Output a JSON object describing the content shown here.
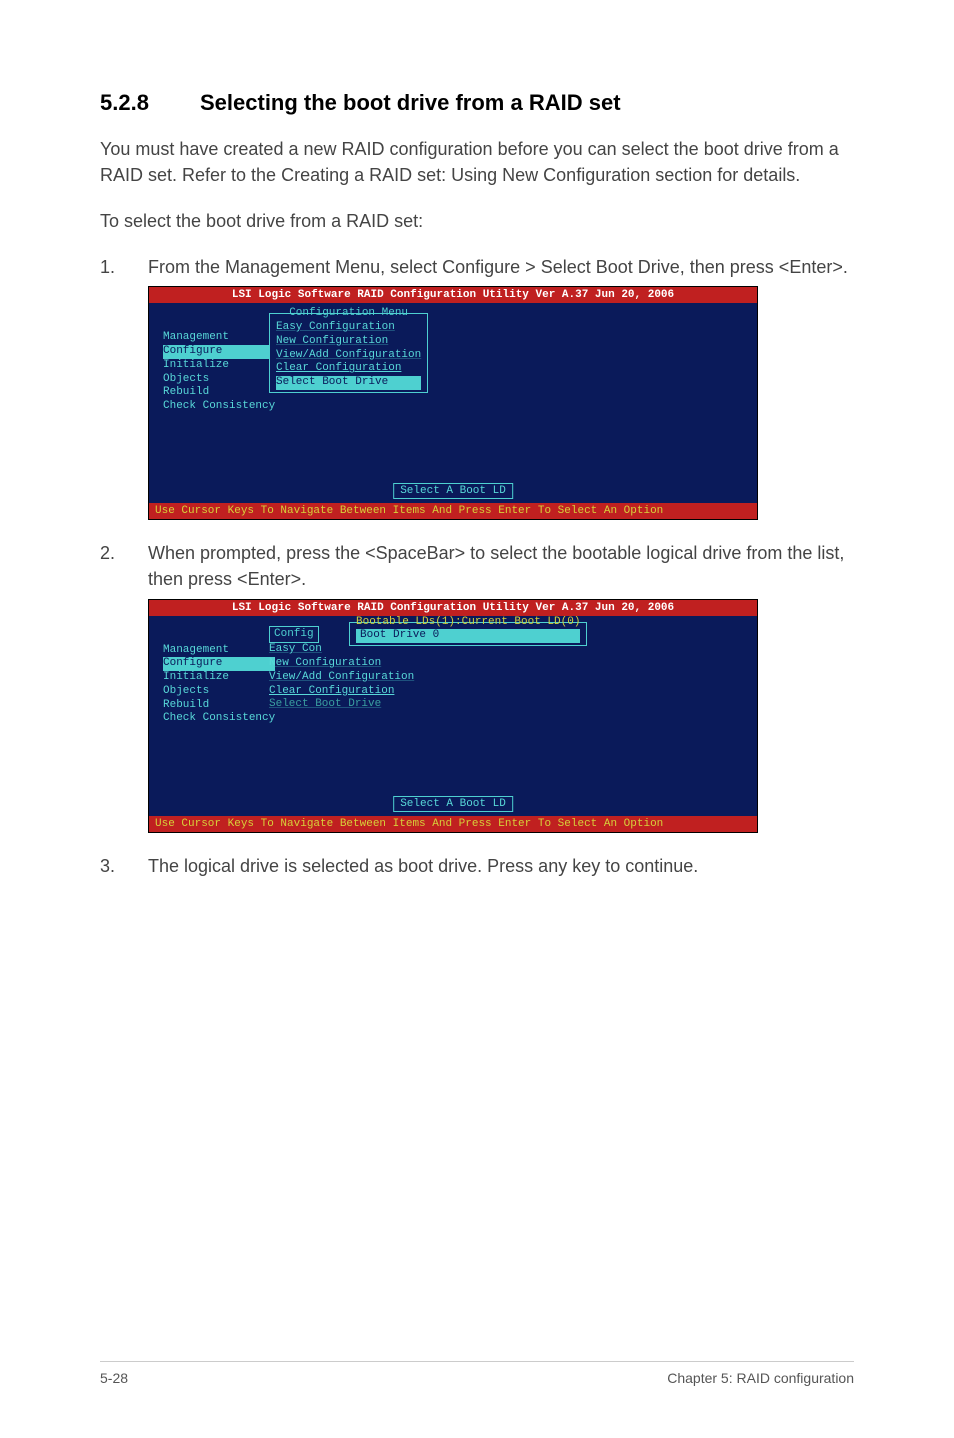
{
  "heading": {
    "number": "5.2.8",
    "title": "Selecting the boot drive from a RAID set"
  },
  "intro": "You must have created a new RAID configuration before you can select the boot drive from a RAID set. Refer to the Creating a RAID set: Using New Configuration section for details.",
  "lead": "To select the boot drive from a RAID set:",
  "steps": {
    "s1": {
      "num": "1.",
      "text": "From the Management Menu, select Configure > Select Boot Drive, then press <Enter>."
    },
    "s2": {
      "num": "2.",
      "text": "When prompted, press the <SpaceBar> to select the bootable logical drive from the list, then press <Enter>."
    },
    "s3": {
      "num": "3.",
      "text": "The logical drive is selected as boot drive. Press any key to continue."
    }
  },
  "term": {
    "title": "LSI Logic Software RAID Configuration Utility Ver A.37 Jun 20, 2006",
    "hint": "Use Cursor Keys To Navigate Between Items And Press Enter To Select An Option",
    "mgmt": {
      "m0": "Management",
      "m1": "Configure",
      "m2": "Initialize",
      "m3": "Objects",
      "m4": "Rebuild",
      "m5": "Check Consistency"
    },
    "cfg": {
      "title": "Configuration Menu",
      "c0": "Easy Configuration",
      "c1": "New Configuration",
      "c2": "View/Add Configuration",
      "c3": "Clear Configuration",
      "c4": "Select Boot Drive"
    },
    "cfg2label": "Config",
    "cfg2stub": "Easy Con",
    "bootbox": "Select A Boot LD",
    "bootpopup": {
      "title": "Bootable LDs(1):Current Boot LD(0)",
      "item": "Boot Drive 0"
    }
  },
  "footer": {
    "left": "5-28",
    "right": "Chapter 5: RAID configuration"
  }
}
